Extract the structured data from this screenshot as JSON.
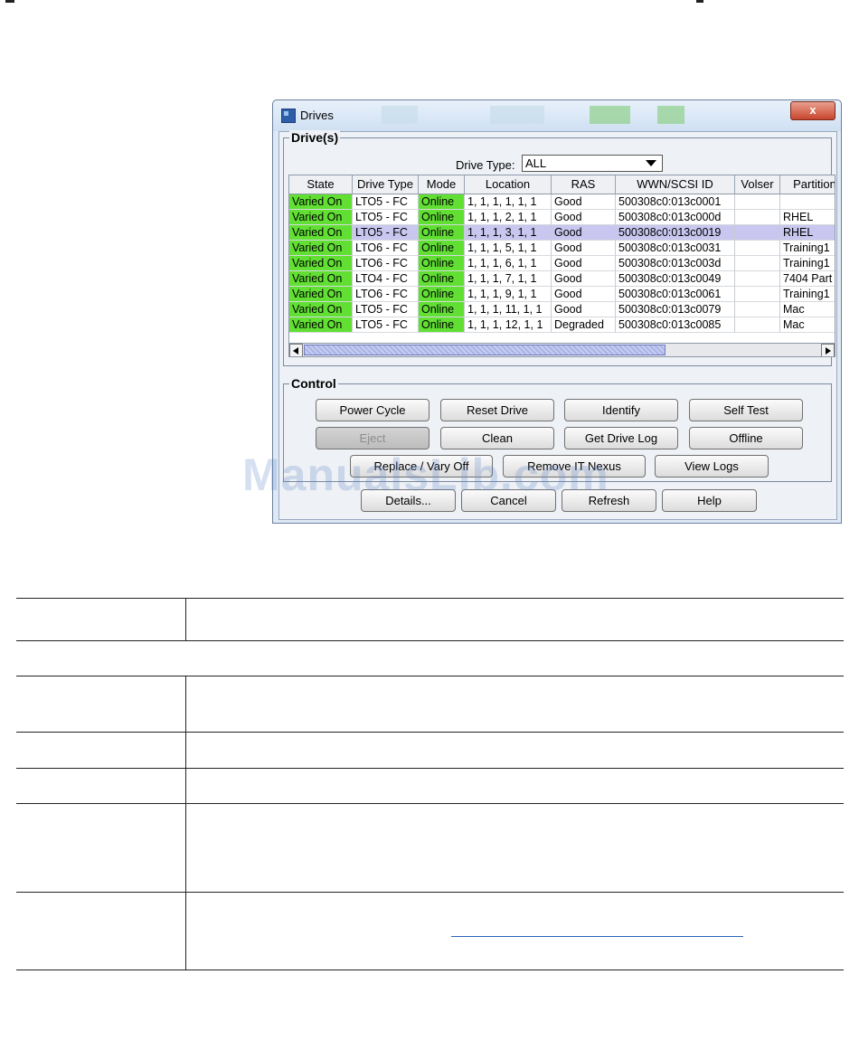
{
  "window": {
    "title": "Drives",
    "close_glyph": "x"
  },
  "drives_group": {
    "legend": "Drive(s)",
    "drive_type_label": "Drive Type:",
    "drive_type_value": "ALL"
  },
  "table": {
    "columns": [
      "State",
      "Drive Type",
      "Mode",
      "Location",
      "RAS",
      "WWN/SCSI ID",
      "Volser",
      "Partition"
    ],
    "rows": [
      {
        "state": "Varied On",
        "drive_type": "LTO5 - FC",
        "mode": "Online",
        "location": "1, 1, 1, 1, 1, 1",
        "ras": "Good",
        "wwn": "500308c0:013c0001",
        "volser": "",
        "partition": ""
      },
      {
        "state": "Varied On",
        "drive_type": "LTO5 - FC",
        "mode": "Online",
        "location": "1, 1, 1, 2, 1, 1",
        "ras": "Good",
        "wwn": "500308c0:013c000d",
        "volser": "",
        "partition": "RHEL"
      },
      {
        "state": "Varied On",
        "drive_type": "LTO5 - FC",
        "mode": "Online",
        "location": "1, 1, 1, 3, 1, 1",
        "ras": "Good",
        "wwn": "500308c0:013c0019",
        "volser": "",
        "partition": "RHEL"
      },
      {
        "state": "Varied On",
        "drive_type": "LTO6 - FC",
        "mode": "Online",
        "location": "1, 1, 1, 5, 1, 1",
        "ras": "Good",
        "wwn": "500308c0:013c0031",
        "volser": "",
        "partition": "Training1"
      },
      {
        "state": "Varied On",
        "drive_type": "LTO6 - FC",
        "mode": "Online",
        "location": "1, 1, 1, 6, 1, 1",
        "ras": "Good",
        "wwn": "500308c0:013c003d",
        "volser": "",
        "partition": "Training1"
      },
      {
        "state": "Varied On",
        "drive_type": "LTO4 - FC",
        "mode": "Online",
        "location": "1, 1, 1, 7, 1, 1",
        "ras": "Good",
        "wwn": "500308c0:013c0049",
        "volser": "",
        "partition": "7404 Part"
      },
      {
        "state": "Varied On",
        "drive_type": "LTO6 - FC",
        "mode": "Online",
        "location": "1, 1, 1, 9, 1, 1",
        "ras": "Good",
        "wwn": "500308c0:013c0061",
        "volser": "",
        "partition": "Training1"
      },
      {
        "state": "Varied On",
        "drive_type": "LTO5 - FC",
        "mode": "Online",
        "location": "1, 1, 1, 11, 1, 1",
        "ras": "Good",
        "wwn": "500308c0:013c0079",
        "volser": "",
        "partition": "Mac"
      },
      {
        "state": "Varied On",
        "drive_type": "LTO5 - FC",
        "mode": "Online",
        "location": "1, 1, 1, 12, 1, 1",
        "ras": "Degraded",
        "wwn": "500308c0:013c0085",
        "volser": "",
        "partition": "Mac"
      }
    ],
    "selected_row": 2
  },
  "control_group": {
    "legend": "Control",
    "power_cycle": "Power Cycle",
    "reset_drive": "Reset Drive",
    "identify": "Identify",
    "self_test": "Self Test",
    "eject": "Eject",
    "clean": "Clean",
    "get_drive_log": "Get Drive Log",
    "offline": "Offline",
    "replace_vary_off": "Replace / Vary Off",
    "remove_it_nexus": "Remove IT Nexus",
    "view_logs": "View Logs"
  },
  "footer_buttons": {
    "details": "Details...",
    "cancel": "Cancel",
    "refresh": "Refresh",
    "help": "Help"
  },
  "watermark": "ManualsLib.com",
  "colors": {
    "state_ok": "#61e033",
    "selected_row": "#c9c6ef",
    "window_frame": "#dfe9f5"
  }
}
